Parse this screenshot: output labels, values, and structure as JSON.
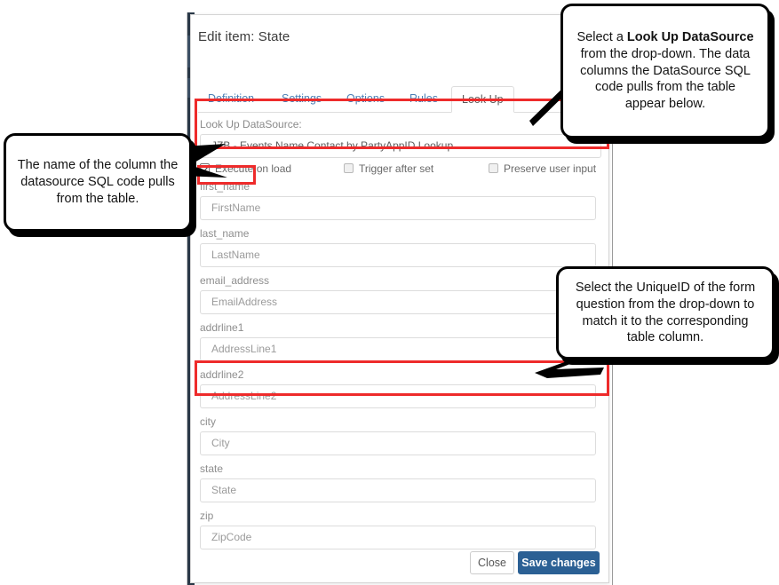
{
  "dialog": {
    "title": "Edit item: State",
    "tabs": [
      {
        "label": "Definition",
        "active": false
      },
      {
        "label": "Settings",
        "active": false
      },
      {
        "label": "Options",
        "active": false
      },
      {
        "label": "Rules",
        "active": false
      },
      {
        "label": "Look Up",
        "active": true
      }
    ],
    "datasource": {
      "label": "Look Up DataSource:",
      "value": "JZB - Events Name Contact by PartyAppID Lookup"
    },
    "checkboxes": [
      {
        "label": "Execute on load",
        "checked": true
      },
      {
        "label": "Trigger after set",
        "checked": false
      },
      {
        "label": "Preserve user input",
        "checked": false
      }
    ],
    "mappings": [
      {
        "column": "first_name",
        "value": "FirstName"
      },
      {
        "column": "last_name",
        "value": "LastName"
      },
      {
        "column": "email_address",
        "value": "EmailAddress"
      },
      {
        "column": "addrline1",
        "value": "AddressLine1"
      },
      {
        "column": "addrline2",
        "value": "AddressLine2"
      },
      {
        "column": "city",
        "value": "City"
      },
      {
        "column": "state",
        "value": "State"
      },
      {
        "column": "zip",
        "value": "ZipCode"
      }
    ],
    "footer": {
      "close_label": "Close",
      "save_label": "Save changes"
    }
  },
  "annotations": {
    "datasource_callout": {
      "line1_pre": "Select a ",
      "line1_bold": "Look Up DataSource",
      "line1_post": " from the drop-down. The data columns the DataSource SQL code pulls from the table appear below."
    },
    "column_callout": {
      "text": "The name of the column the datasource SQL code pulls from the table."
    },
    "uniqueid_callout": {
      "text": "Select the UniqueID of the form question from the drop-down to match it to the corresponding table column."
    }
  },
  "colors": {
    "highlight": "#ee2b2b",
    "primary_button": "#2b6094",
    "tab_link": "#4a7fb5",
    "label_gray": "#8e8e8e"
  }
}
